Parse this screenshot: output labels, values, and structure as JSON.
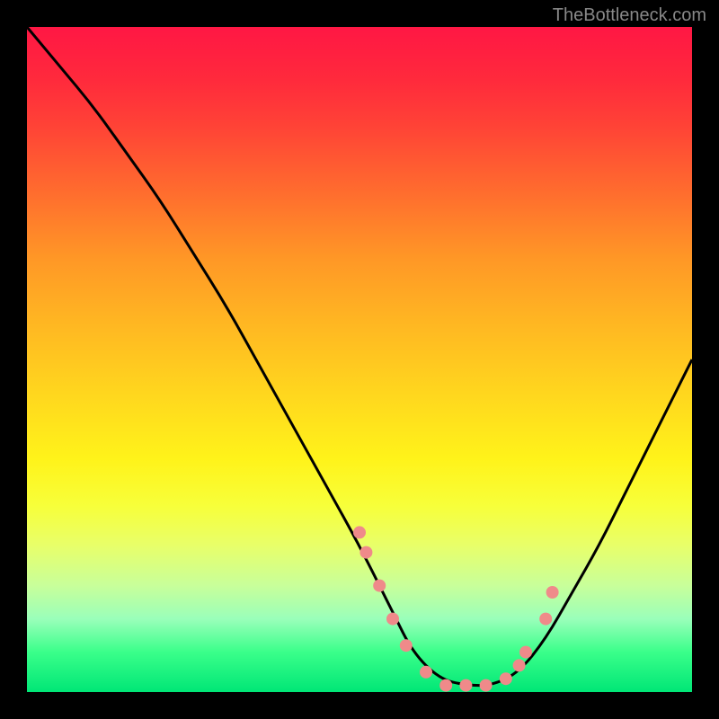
{
  "watermark": "TheBottleneck.com",
  "chart_data": {
    "type": "line",
    "title": "",
    "xlabel": "",
    "ylabel": "",
    "xlim": [
      0,
      100
    ],
    "ylim": [
      0,
      100
    ],
    "description": "Bottleneck curve — V-shaped performance curve over vertical heat gradient (red=bad at top, green=good at bottom). The curve descends from top-left to a wide trough near x≈58-72 and rises again toward the right.",
    "series": [
      {
        "name": "bottleneck-curve",
        "x": [
          0,
          5,
          10,
          15,
          20,
          25,
          30,
          35,
          40,
          45,
          50,
          55,
          58,
          62,
          66,
          70,
          74,
          78,
          82,
          86,
          90,
          95,
          100
        ],
        "y": [
          100,
          94,
          88,
          81,
          74,
          66,
          58,
          49,
          40,
          31,
          22,
          12,
          6,
          2,
          1,
          1,
          3,
          8,
          15,
          22,
          30,
          40,
          50
        ]
      }
    ],
    "scatter_points": {
      "name": "dot-markers",
      "color": "#ef8a8a",
      "x": [
        50,
        51,
        53,
        55,
        57,
        60,
        63,
        66,
        69,
        72,
        74,
        75,
        78,
        79
      ],
      "y": [
        24,
        21,
        16,
        11,
        7,
        3,
        1,
        1,
        1,
        2,
        4,
        6,
        11,
        15
      ]
    },
    "gradient_stops": [
      {
        "pos": 0.0,
        "color": "#ff1744"
      },
      {
        "pos": 0.25,
        "color": "#ff6d2e"
      },
      {
        "pos": 0.55,
        "color": "#ffd61e"
      },
      {
        "pos": 0.78,
        "color": "#e8ff6a"
      },
      {
        "pos": 1.0,
        "color": "#00e676"
      }
    ]
  }
}
